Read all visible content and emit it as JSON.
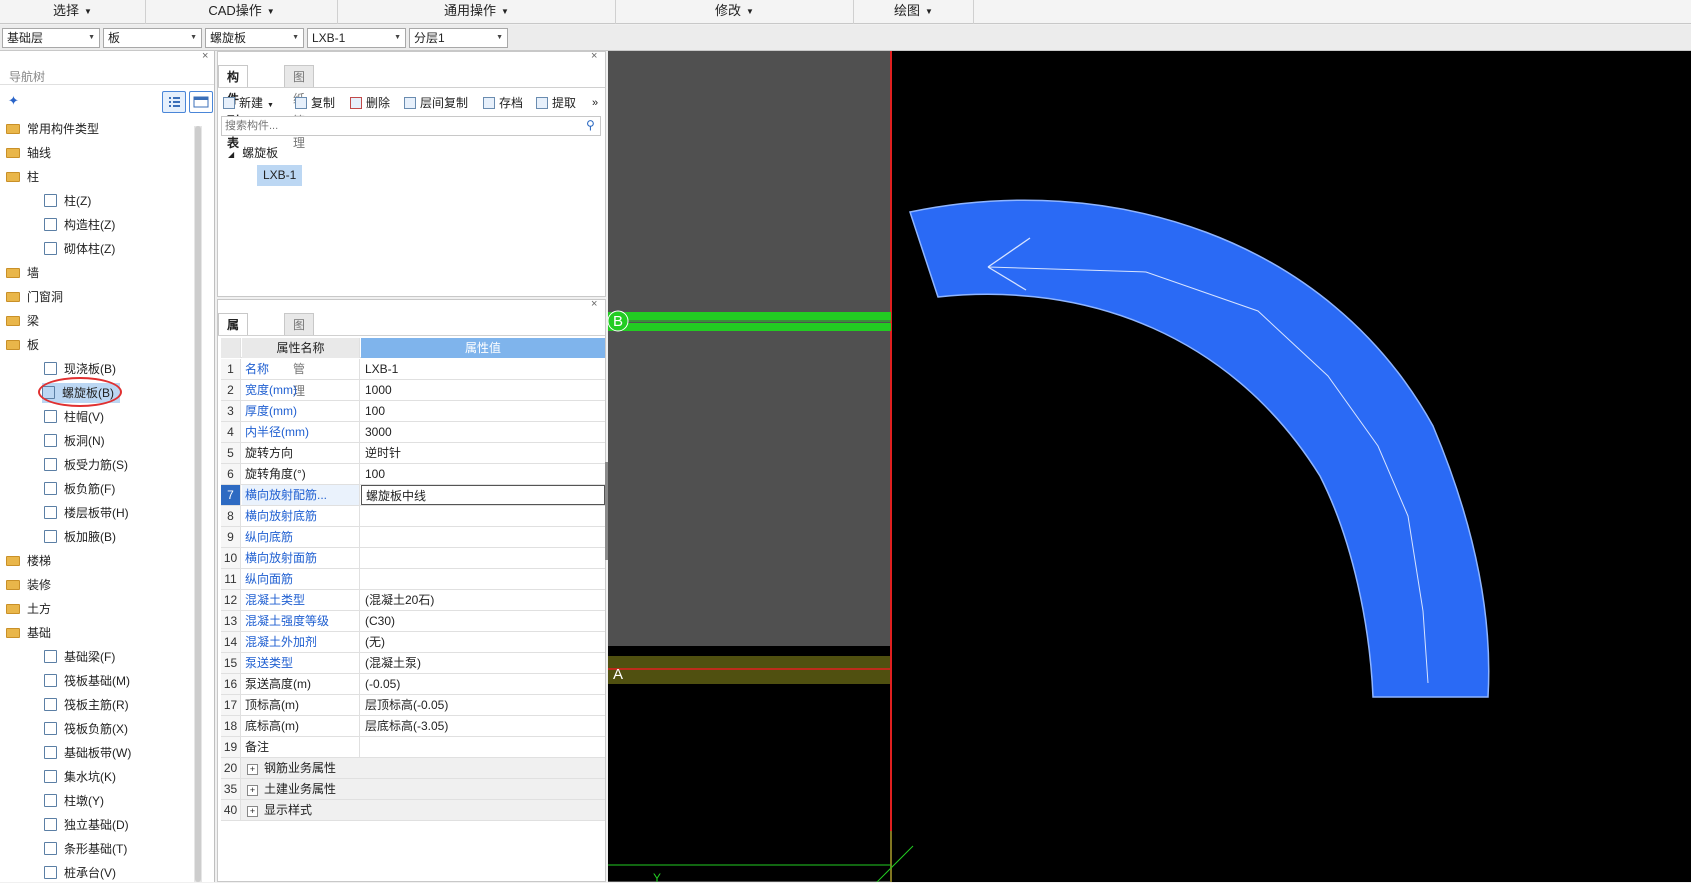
{
  "menubar": {
    "items": [
      "选择",
      "CAD操作",
      "通用操作",
      "修改",
      "绘图"
    ]
  },
  "selectors": [
    "基础层",
    "板",
    "螺旋板",
    "LXB-1",
    "分层1"
  ],
  "nav": {
    "title": "导航树",
    "close": "×",
    "items": [
      {
        "label": "常用构件类型",
        "type": "folder"
      },
      {
        "label": "轴线",
        "type": "folder"
      },
      {
        "label": "柱",
        "type": "folder"
      },
      {
        "label": "柱(Z)",
        "type": "item"
      },
      {
        "label": "构造柱(Z)",
        "type": "item"
      },
      {
        "label": "砌体柱(Z)",
        "type": "item"
      },
      {
        "label": "墙",
        "type": "folder"
      },
      {
        "label": "门窗洞",
        "type": "folder"
      },
      {
        "label": "梁",
        "type": "folder"
      },
      {
        "label": "板",
        "type": "folder"
      },
      {
        "label": "现浇板(B)",
        "type": "item"
      },
      {
        "label": "螺旋板(B)",
        "type": "item",
        "selected": true
      },
      {
        "label": "柱帽(V)",
        "type": "item"
      },
      {
        "label": "板洞(N)",
        "type": "item"
      },
      {
        "label": "板受力筋(S)",
        "type": "item"
      },
      {
        "label": "板负筋(F)",
        "type": "item"
      },
      {
        "label": "楼层板带(H)",
        "type": "item"
      },
      {
        "label": "板加腋(B)",
        "type": "item"
      },
      {
        "label": "楼梯",
        "type": "folder"
      },
      {
        "label": "装修",
        "type": "folder"
      },
      {
        "label": "土方",
        "type": "folder"
      },
      {
        "label": "基础",
        "type": "folder"
      },
      {
        "label": "基础梁(F)",
        "type": "item"
      },
      {
        "label": "筏板基础(M)",
        "type": "item"
      },
      {
        "label": "筏板主筋(R)",
        "type": "item"
      },
      {
        "label": "筏板负筋(X)",
        "type": "item"
      },
      {
        "label": "基础板带(W)",
        "type": "item"
      },
      {
        "label": "集水坑(K)",
        "type": "item"
      },
      {
        "label": "柱墩(Y)",
        "type": "item"
      },
      {
        "label": "独立基础(D)",
        "type": "item"
      },
      {
        "label": "条形基础(T)",
        "type": "item"
      },
      {
        "label": "桩承台(V)",
        "type": "item"
      }
    ]
  },
  "complist": {
    "tabs": [
      "构件列表",
      "图纸管理"
    ],
    "toolbar": [
      "新建",
      "复制",
      "删除",
      "层间复制",
      "存档",
      "提取"
    ],
    "more": "»",
    "search_placeholder": "搜索构件...",
    "tree_parent": "螺旋板",
    "tree_child": "LXB-1"
  },
  "proplist": {
    "tabs": [
      "属性列表",
      "图层管理"
    ],
    "header_name": "属性名称",
    "header_value": "属性值",
    "rows": [
      {
        "n": "1",
        "k": "名称",
        "v": "LXB-1",
        "blue": true
      },
      {
        "n": "2",
        "k": "宽度(mm)",
        "v": "1000",
        "blue": true
      },
      {
        "n": "3",
        "k": "厚度(mm)",
        "v": "100",
        "blue": true
      },
      {
        "n": "4",
        "k": "内半径(mm)",
        "v": "3000",
        "blue": true
      },
      {
        "n": "5",
        "k": "旋转方向",
        "v": "逆时针",
        "blue": false
      },
      {
        "n": "6",
        "k": "旋转角度(°)",
        "v": "100",
        "blue": false
      },
      {
        "n": "7",
        "k": "横向放射配筋...",
        "v": "螺旋板中线",
        "blue": true,
        "active": true
      },
      {
        "n": "8",
        "k": "横向放射底筋",
        "v": "",
        "blue": true
      },
      {
        "n": "9",
        "k": "纵向底筋",
        "v": "",
        "blue": true
      },
      {
        "n": "10",
        "k": "横向放射面筋",
        "v": "",
        "blue": true
      },
      {
        "n": "11",
        "k": "纵向面筋",
        "v": "",
        "blue": true
      },
      {
        "n": "12",
        "k": "混凝土类型",
        "v": "(混凝土20石)",
        "blue": true
      },
      {
        "n": "13",
        "k": "混凝土强度等级",
        "v": "(C30)",
        "blue": true
      },
      {
        "n": "14",
        "k": "混凝土外加剂",
        "v": "(无)",
        "blue": true
      },
      {
        "n": "15",
        "k": "泵送类型",
        "v": "(混凝土泵)",
        "blue": true
      },
      {
        "n": "16",
        "k": "泵送高度(m)",
        "v": "(-0.05)",
        "blue": false
      },
      {
        "n": "17",
        "k": "顶标高(m)",
        "v": "层顶标高(-0.05)",
        "blue": false
      },
      {
        "n": "18",
        "k": "底标高(m)",
        "v": "层底标高(-3.05)",
        "blue": false
      },
      {
        "n": "19",
        "k": "备注",
        "v": "",
        "blue": false
      }
    ],
    "groups": [
      {
        "n": "20",
        "k": "钢筋业务属性"
      },
      {
        "n": "35",
        "k": "土建业务属性"
      },
      {
        "n": "40",
        "k": "显示样式"
      }
    ]
  },
  "canvas": {
    "axis_b": "B",
    "axis_a": "A",
    "axis_y": "Y"
  },
  "colors": {
    "slab": "#2a6af5",
    "axis_green": "#22cc22",
    "gray_area": "#505050"
  }
}
